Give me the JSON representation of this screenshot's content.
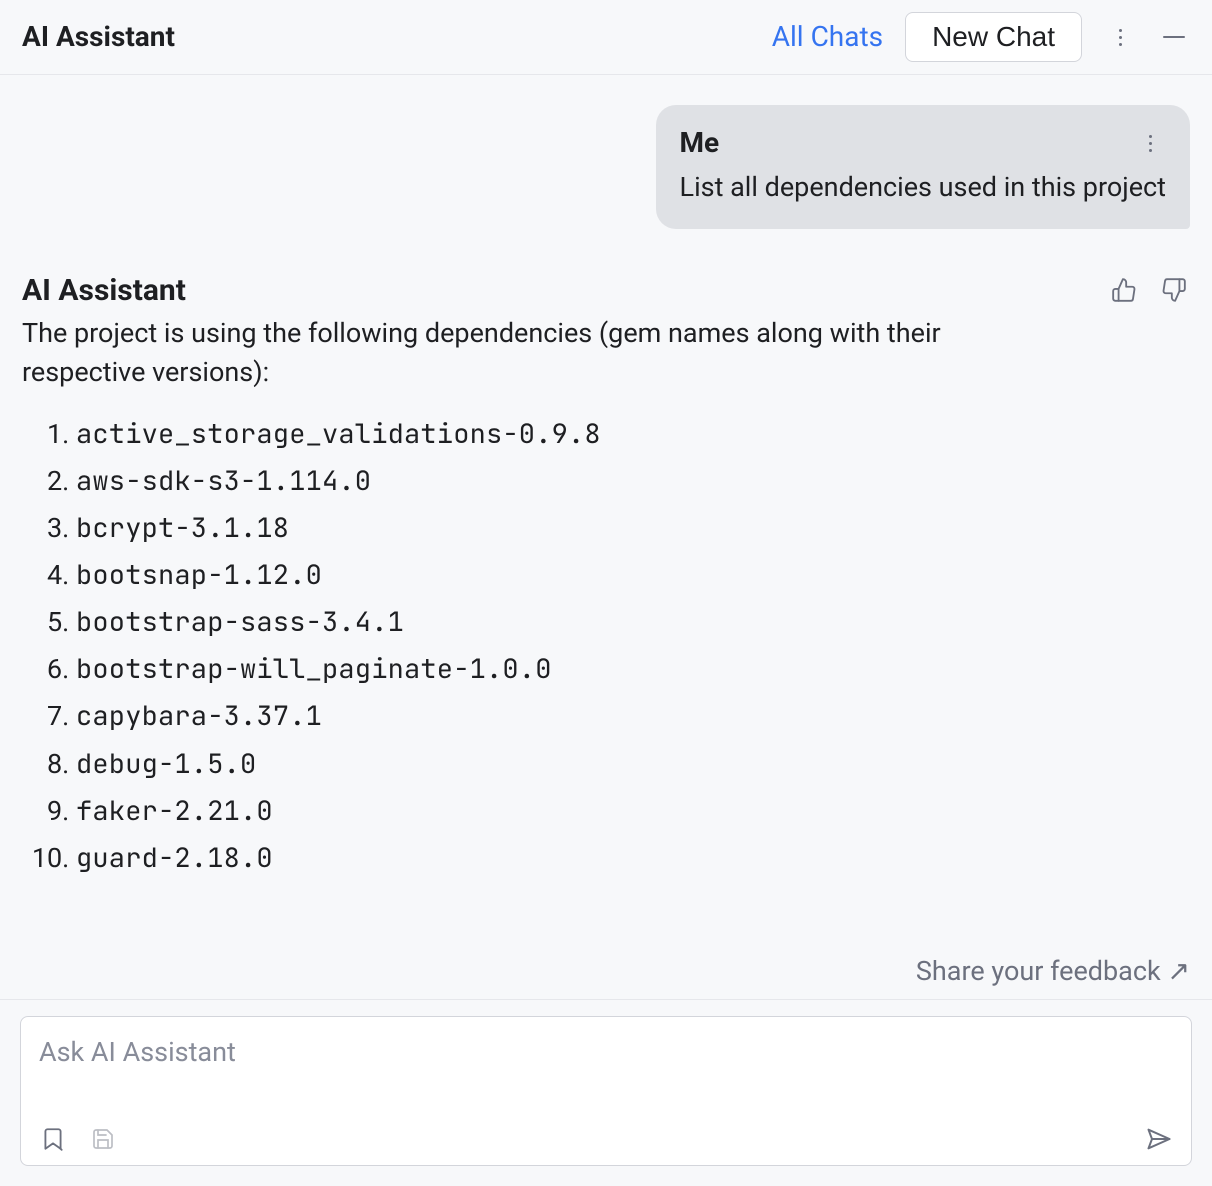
{
  "header": {
    "title": "AI Assistant",
    "all_chats_label": "All Chats",
    "new_chat_label": "New Chat"
  },
  "conversation": {
    "user": {
      "name": "Me",
      "message": "List all dependencies used in this project"
    },
    "assistant": {
      "name": "AI Assistant",
      "intro": "The project is using the following dependencies (gem names along with their respective versions):",
      "dependencies": [
        "active_storage_validations-0.9.8",
        "aws-sdk-s3-1.114.0",
        "bcrypt-3.1.18",
        "bootsnap-1.12.0",
        "bootstrap-sass-3.4.1",
        "bootstrap-will_paginate-1.0.0",
        "capybara-3.37.1",
        "debug-1.5.0",
        "faker-2.21.0",
        "guard-2.18.0"
      ]
    }
  },
  "footer": {
    "share_feedback_label": "Share your feedback ↗",
    "input_placeholder": "Ask AI Assistant"
  }
}
